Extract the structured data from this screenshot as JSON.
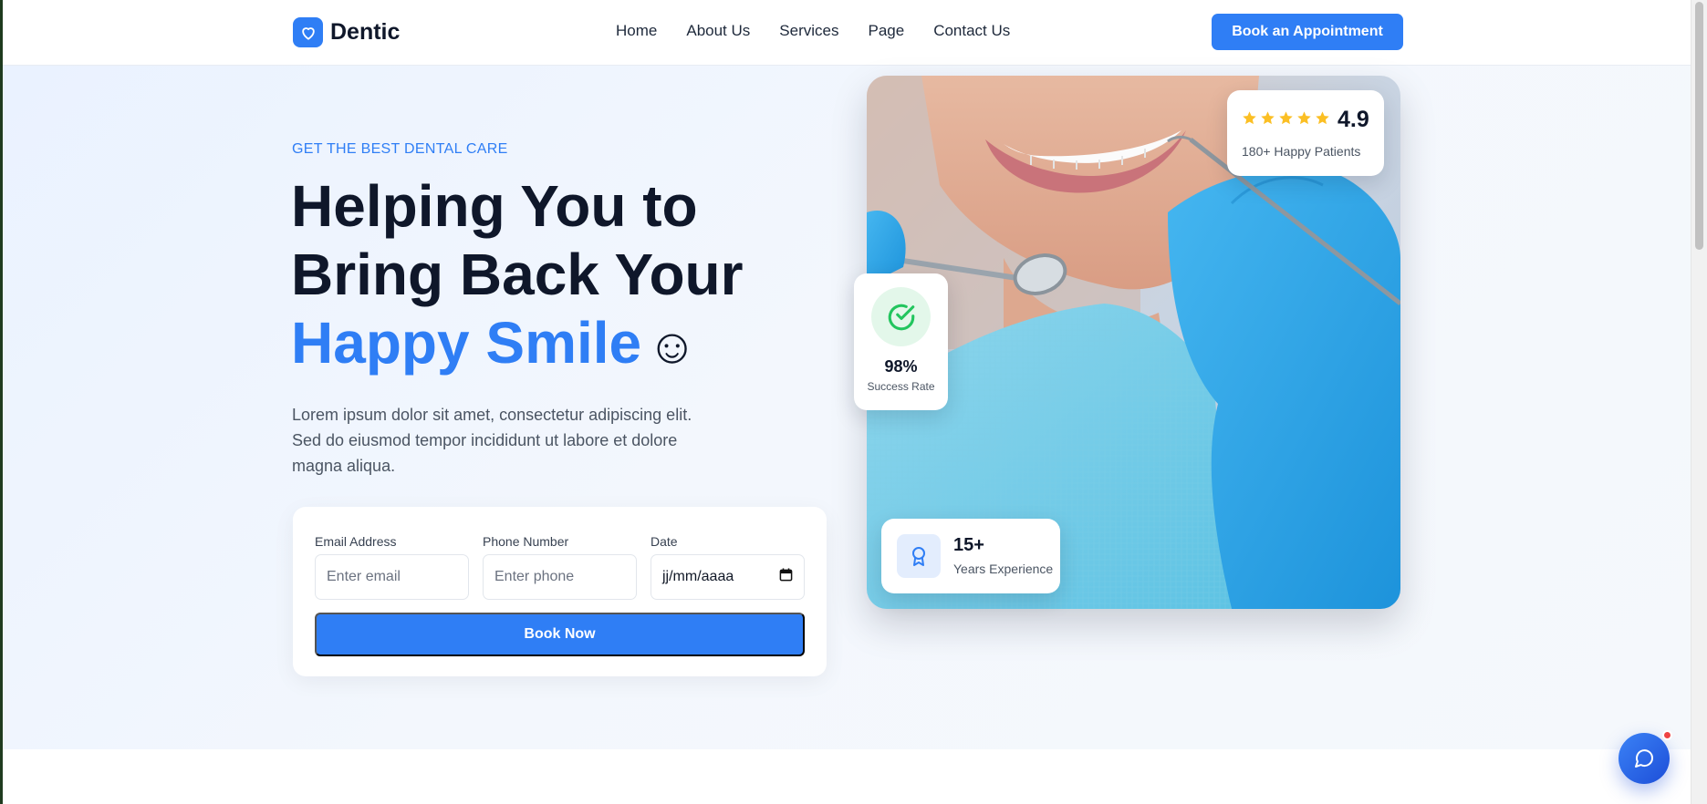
{
  "brand": {
    "name": "Dentic",
    "icon": "heart-icon",
    "accent": "#2f7ef5"
  },
  "nav": {
    "items": [
      {
        "label": "Home"
      },
      {
        "label": "About Us"
      },
      {
        "label": "Services"
      },
      {
        "label": "Page"
      },
      {
        "label": "Contact Us"
      }
    ],
    "cta_label": "Book an Appointment"
  },
  "hero": {
    "eyebrow": "GET THE BEST DENTAL CARE",
    "headline_line1": "Helping You to",
    "headline_line2": "Bring Back Your",
    "headline_accent": "Happy Smile",
    "headline_emoji": "☺",
    "lead": "Lorem ipsum dolor sit amet, consectetur adipiscing elit. Sed do eiusmod tempor incididunt ut labore et dolore magna aliqua."
  },
  "form": {
    "email_label": "Email Address",
    "email_placeholder": "Enter email",
    "phone_label": "Phone Number",
    "phone_placeholder": "Enter phone",
    "date_label": "Date",
    "date_value": "jj/mm/aaaa",
    "submit_label": "Book Now"
  },
  "stats": {
    "rating": {
      "value": "4.9",
      "stars": 5,
      "label": "180+ Happy Patients",
      "star_color": "#fbbf24"
    },
    "success": {
      "value": "98%",
      "label": "Success Rate",
      "icon": "check-circle-icon",
      "color": "#22c55e"
    },
    "experience": {
      "value": "15+",
      "label": "Years Experience",
      "icon": "award-icon"
    }
  },
  "chat": {
    "icon": "chat-bubble-icon",
    "badge_color": "#ef4444"
  }
}
